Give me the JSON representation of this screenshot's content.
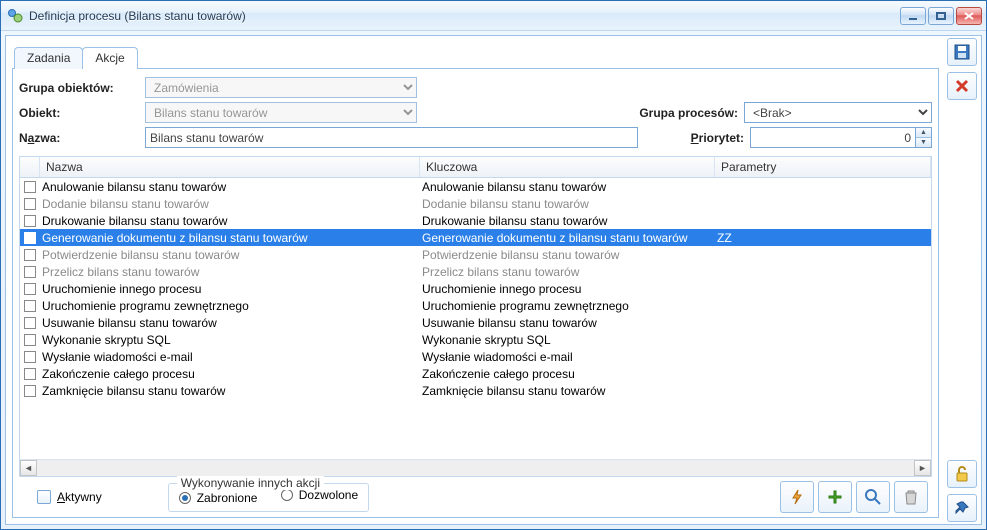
{
  "window": {
    "title": "Definicja procesu (Bilans stanu towarów)"
  },
  "tabs": {
    "zadania": "Zadania",
    "akcje": "Akcje",
    "active": "akcje"
  },
  "form": {
    "grupa_obiektow": {
      "label": "Grupa obiektów:",
      "value": "Zamówienia"
    },
    "obiekt": {
      "label": "Obiekt:",
      "value": "Bilans stanu towarów"
    },
    "grupa_procesow": {
      "label": "Grupa procesów:",
      "value": "<Brak>"
    },
    "nazwa": {
      "label_pre": "N",
      "label_u": "a",
      "label_post": "zwa:",
      "value": "Bilans stanu towarów"
    },
    "priorytet": {
      "label_u": "P",
      "label_post": "riorytet:",
      "value": "0"
    }
  },
  "columns": {
    "nazwa": "Nazwa",
    "kluczowa": "Kluczowa",
    "parametry": "Parametry"
  },
  "rows": [
    {
      "n": "Anulowanie bilansu stanu towarów",
      "k": "Anulowanie bilansu stanu towarów",
      "p": "",
      "state": ""
    },
    {
      "n": "Dodanie bilansu stanu towarów",
      "k": "Dodanie bilansu stanu towarów",
      "p": "",
      "state": "disabled"
    },
    {
      "n": "Drukowanie bilansu stanu towarów",
      "k": "Drukowanie bilansu stanu towarów",
      "p": "",
      "state": ""
    },
    {
      "n": "Generowanie dokumentu z bilansu stanu towarów",
      "k": "Generowanie dokumentu z bilansu stanu towarów",
      "p": "ZZ",
      "state": "selected"
    },
    {
      "n": "Potwierdzenie bilansu stanu towarów",
      "k": "Potwierdzenie bilansu stanu towarów",
      "p": "",
      "state": "disabled"
    },
    {
      "n": "Przelicz bilans stanu towarów",
      "k": "Przelicz bilans stanu towarów",
      "p": "",
      "state": "disabled"
    },
    {
      "n": "Uruchomienie innego procesu",
      "k": "Uruchomienie innego procesu",
      "p": "",
      "state": ""
    },
    {
      "n": "Uruchomienie programu zewnętrznego",
      "k": "Uruchomienie programu zewnętrznego",
      "p": "",
      "state": ""
    },
    {
      "n": "Usuwanie bilansu stanu towarów",
      "k": "Usuwanie bilansu stanu towarów",
      "p": "",
      "state": ""
    },
    {
      "n": "Wykonanie skryptu SQL",
      "k": "Wykonanie skryptu SQL",
      "p": "",
      "state": ""
    },
    {
      "n": "Wysłanie wiadomości e-mail",
      "k": "Wysłanie wiadomości e-mail",
      "p": "",
      "state": ""
    },
    {
      "n": "Zakończenie całego procesu",
      "k": "Zakończenie całego procesu",
      "p": "",
      "state": ""
    },
    {
      "n": "Zamknięcie bilansu stanu towarów",
      "k": "Zamknięcie bilansu stanu towarów",
      "p": "",
      "state": ""
    }
  ],
  "bottom": {
    "aktywny_u": "A",
    "aktywny_post": "ktywny",
    "group_title": "Wykonywanie innych akcji",
    "opt_zabronione": "Zabronione",
    "opt_dozwolone": "Dozwolone"
  }
}
